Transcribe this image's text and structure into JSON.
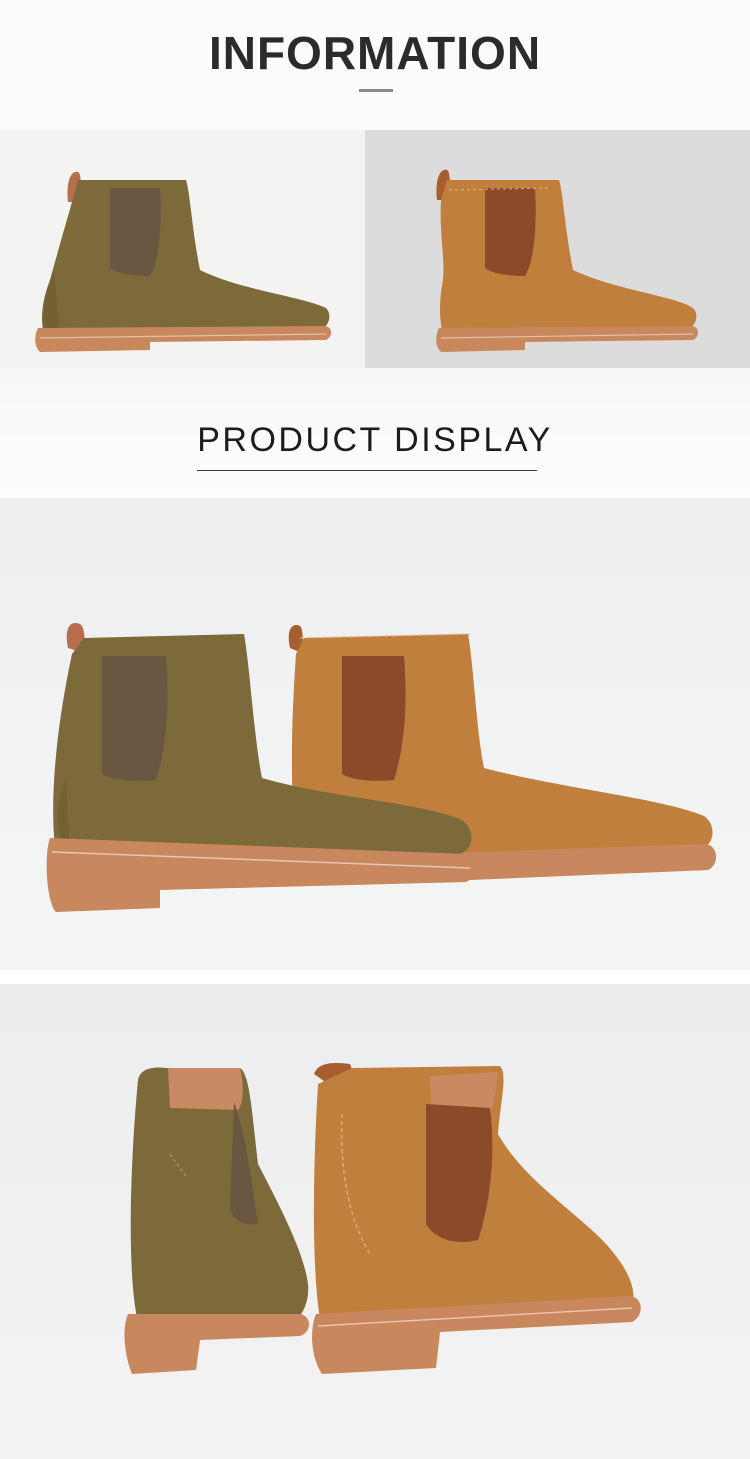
{
  "info_section": {
    "title": "INFORMATION"
  },
  "variants": [
    {
      "color_name": "olive",
      "upper": "#7d6a3a",
      "elastic": "#6b5641",
      "sole": "#c9875d"
    },
    {
      "color_name": "tan",
      "upper": "#c07f3d",
      "elastic": "#8b4a2a",
      "sole": "#c9875d"
    }
  ],
  "display_section": {
    "title": "PRODUCT DISPLAY"
  },
  "colors": {
    "olive_suede": "#7d6a3a",
    "tan_suede": "#c07f3d",
    "crepe_sole": "#c9875d",
    "text_dark": "#2b2b2b"
  }
}
